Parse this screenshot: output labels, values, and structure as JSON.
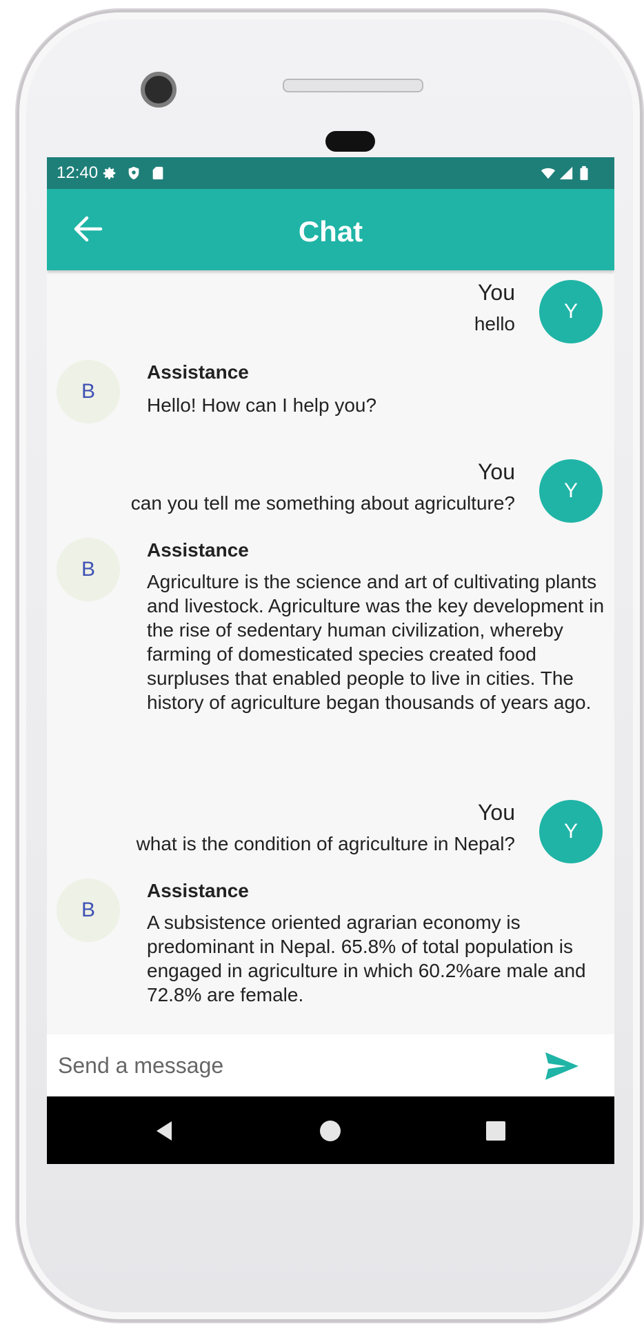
{
  "status_bar": {
    "time": "12:40"
  },
  "app_bar": {
    "title": "Chat"
  },
  "messages": [
    {
      "sender": "You",
      "avatar": "Y",
      "text": "hello"
    },
    {
      "sender": "Assistance",
      "avatar": "B",
      "text": "Hello! How can I help you?"
    },
    {
      "sender": "You",
      "avatar": "Y",
      "text": "can you tell me something about agriculture?"
    },
    {
      "sender": "Assistance",
      "avatar": "B",
      "text": "Agriculture is the science and art of cultivating plants and livestock. Agriculture was the key development in the rise of sedentary human civilization, whereby farming of domesticated species created food surpluses that enabled people to live in cities. The history of agriculture began thousands of years ago."
    },
    {
      "sender": "You",
      "avatar": "Y",
      "text": "what is the condition of agriculture in Nepal?"
    },
    {
      "sender": "Assistance",
      "avatar": "B",
      "text": "A subsistence oriented agrarian economy is predominant in Nepal. 65.8% of total population is engaged in agriculture in which 60.2%are male and 72.8% are female."
    }
  ],
  "composer": {
    "placeholder": "Send a message"
  },
  "colors": {
    "accent": "#1fb4a6",
    "status_bar": "#1e7f79",
    "bot_avatar_bg": "#eef1e5",
    "bot_avatar_text": "#3f51b5"
  }
}
